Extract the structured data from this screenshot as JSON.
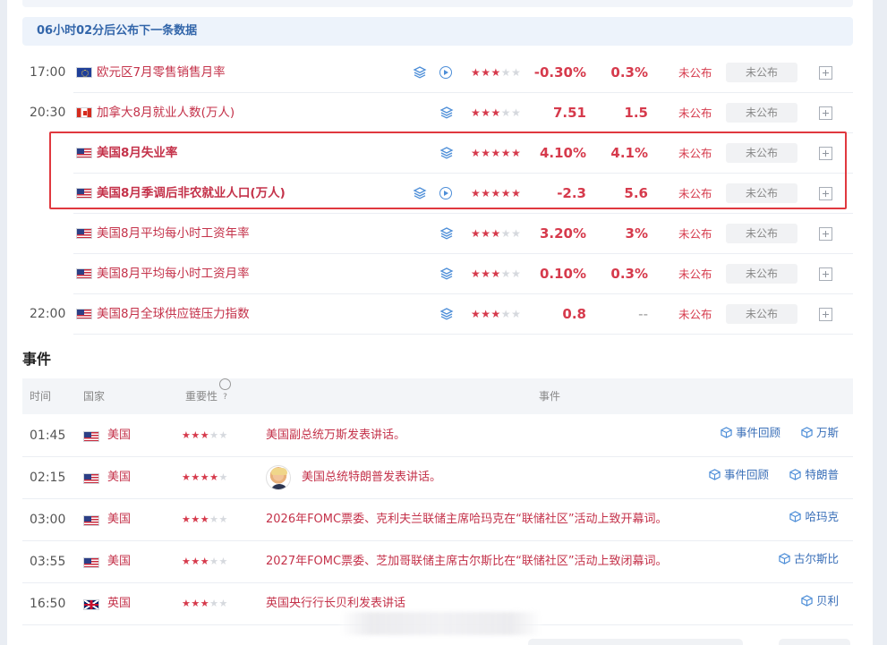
{
  "banner": {
    "text": "06小时02分后公布下一条数据"
  },
  "data_rows": [
    {
      "time": "17:00",
      "flag": "eu",
      "name": "欧元区7月零售销售月率",
      "bold": false,
      "layers": true,
      "video": true,
      "stars": 3,
      "previous": "-0.30%",
      "forecast": "0.3%",
      "actual": "未公布",
      "status": "未公布"
    },
    {
      "time": "20:30",
      "flag": "ca",
      "name": "加拿大8月就业人数(万人)",
      "bold": false,
      "layers": true,
      "video": false,
      "stars": 3,
      "previous": "7.51",
      "forecast": "1.5",
      "actual": "未公布",
      "status": "未公布"
    },
    {
      "time": "",
      "flag": "us",
      "name": "美国8月失业率",
      "bold": true,
      "layers": true,
      "video": false,
      "stars": 5,
      "previous": "4.10%",
      "forecast": "4.1%",
      "actual": "未公布",
      "status": "未公布"
    },
    {
      "time": "",
      "flag": "us",
      "name": "美国8月季调后非农就业人口(万人)",
      "bold": true,
      "layers": true,
      "video": true,
      "stars": 5,
      "previous": "-2.3",
      "forecast": "5.6",
      "actual": "未公布",
      "status": "未公布"
    },
    {
      "time": "",
      "flag": "us",
      "name": "美国8月平均每小时工资年率",
      "bold": false,
      "layers": true,
      "video": false,
      "stars": 3,
      "previous": "3.20%",
      "forecast": "3%",
      "actual": "未公布",
      "status": "未公布"
    },
    {
      "time": "",
      "flag": "us",
      "name": "美国8月平均每小时工资月率",
      "bold": false,
      "layers": true,
      "video": false,
      "stars": 3,
      "previous": "0.10%",
      "forecast": "0.3%",
      "actual": "未公布",
      "status": "未公布"
    },
    {
      "time": "22:00",
      "flag": "us",
      "name": "美国8月全球供应链压力指数",
      "bold": false,
      "layers": true,
      "video": false,
      "stars": 3,
      "previous": "0.8",
      "forecast": "--",
      "actual": "未公布",
      "status": "未公布"
    }
  ],
  "events": {
    "title": "事件",
    "headers": {
      "time": "时间",
      "country": "国家",
      "importance": "重要性",
      "help": "?",
      "event": "事件"
    },
    "rows": [
      {
        "time": "01:45",
        "flag": "us",
        "country": "美国",
        "stars": 3,
        "avatar": false,
        "text": "美国副总统万斯发表讲话。",
        "links": [
          "事件回顾",
          "万斯"
        ]
      },
      {
        "time": "02:15",
        "flag": "us",
        "country": "美国",
        "stars": 4,
        "avatar": true,
        "text": "美国总统特朗普发表讲话。",
        "links": [
          "事件回顾",
          "特朗普"
        ]
      },
      {
        "time": "03:00",
        "flag": "us",
        "country": "美国",
        "stars": 3,
        "avatar": false,
        "text": "2026年FOMC票委、克利夫兰联储主席哈玛克在“联储社区”活动上致开幕词。",
        "links": [
          "哈玛克"
        ]
      },
      {
        "time": "03:55",
        "flag": "us",
        "country": "美国",
        "stars": 3,
        "avatar": false,
        "text": "2027年FOMC票委、芝加哥联储主席古尔斯比在“联储社区”活动上致闭幕词。",
        "links": [
          "古尔斯比"
        ]
      },
      {
        "time": "16:50",
        "flag": "gb",
        "country": "英国",
        "stars": 3,
        "avatar": false,
        "text": "英国央行行长贝利发表讲话",
        "links": [
          "贝利"
        ]
      }
    ]
  },
  "colors": {
    "accent_red": "#d63a4c",
    "link_blue": "#3a6fb8",
    "highlight": "#e0383f"
  }
}
